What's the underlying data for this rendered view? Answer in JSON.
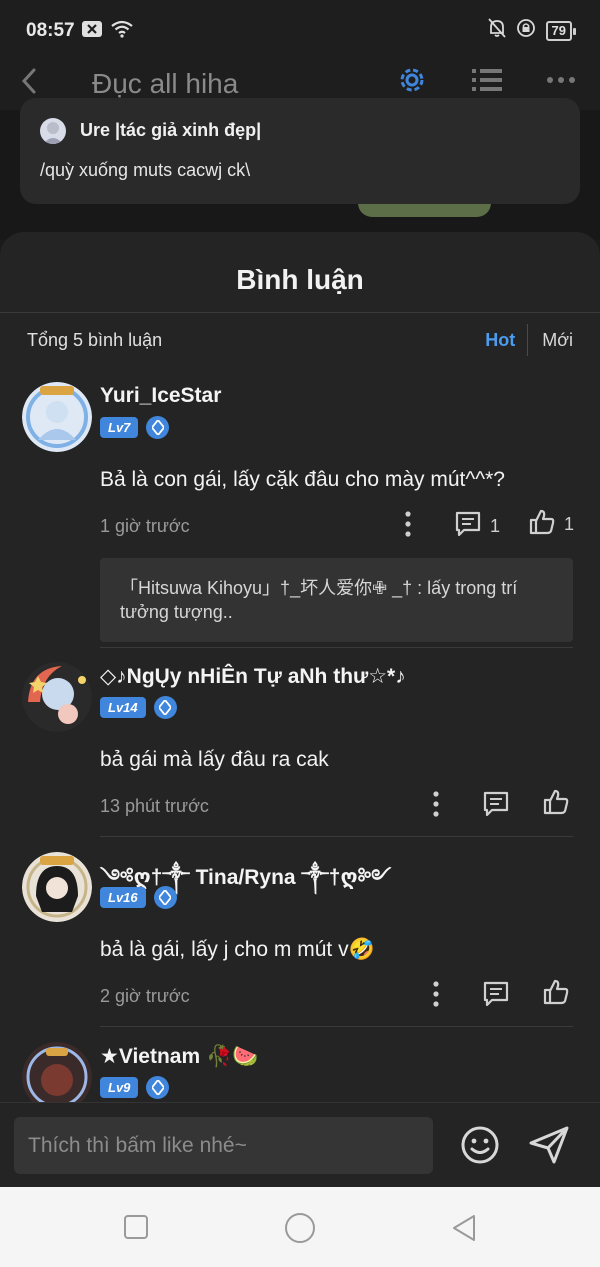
{
  "status_bar": {
    "time": "08:57",
    "battery": "79"
  },
  "app_header": {
    "title": "Đục all hiha"
  },
  "author_card": {
    "name": "Ure |tác giả xinh đẹp|",
    "message": "/quỳ xuống muts cacwj ck\\"
  },
  "comments_sheet": {
    "title": "Bình luận",
    "total": "Tổng 5 bình luận",
    "sort_hot": "Hot",
    "sort_new": "Mới"
  },
  "comments": [
    {
      "username": "Yuri_IceStar",
      "level": "Lv7",
      "text": "Bả là con gái, lấy cặk đâu cho mày mút^^*?",
      "time": "1 giờ trước",
      "reply_count": "1",
      "like_count": "1",
      "reply_preview": "「Hitsuwa Kihoyu」†_坏人爱你✙ _† : lấy trong trí tưởng tượng.."
    },
    {
      "username": "◇♪NgŲy nHiÊn Tự aNh thư☆*♪",
      "level": "Lv14",
      "text": "bả gái mà lấy đâu ra cak",
      "time": "13 phút trước"
    },
    {
      "username": "༺ღ†༒ Tina/Ryna ༒†ღ༻",
      "level": "Lv16",
      "text": "bả là gái, lấy j cho m mút v🤣",
      "time": "2 giờ trước"
    },
    {
      "username": "★Vietnam 🥀🍉",
      "level": "Lv9"
    }
  ],
  "input_bar": {
    "placeholder": "Thích thì bấm like nhé~"
  }
}
